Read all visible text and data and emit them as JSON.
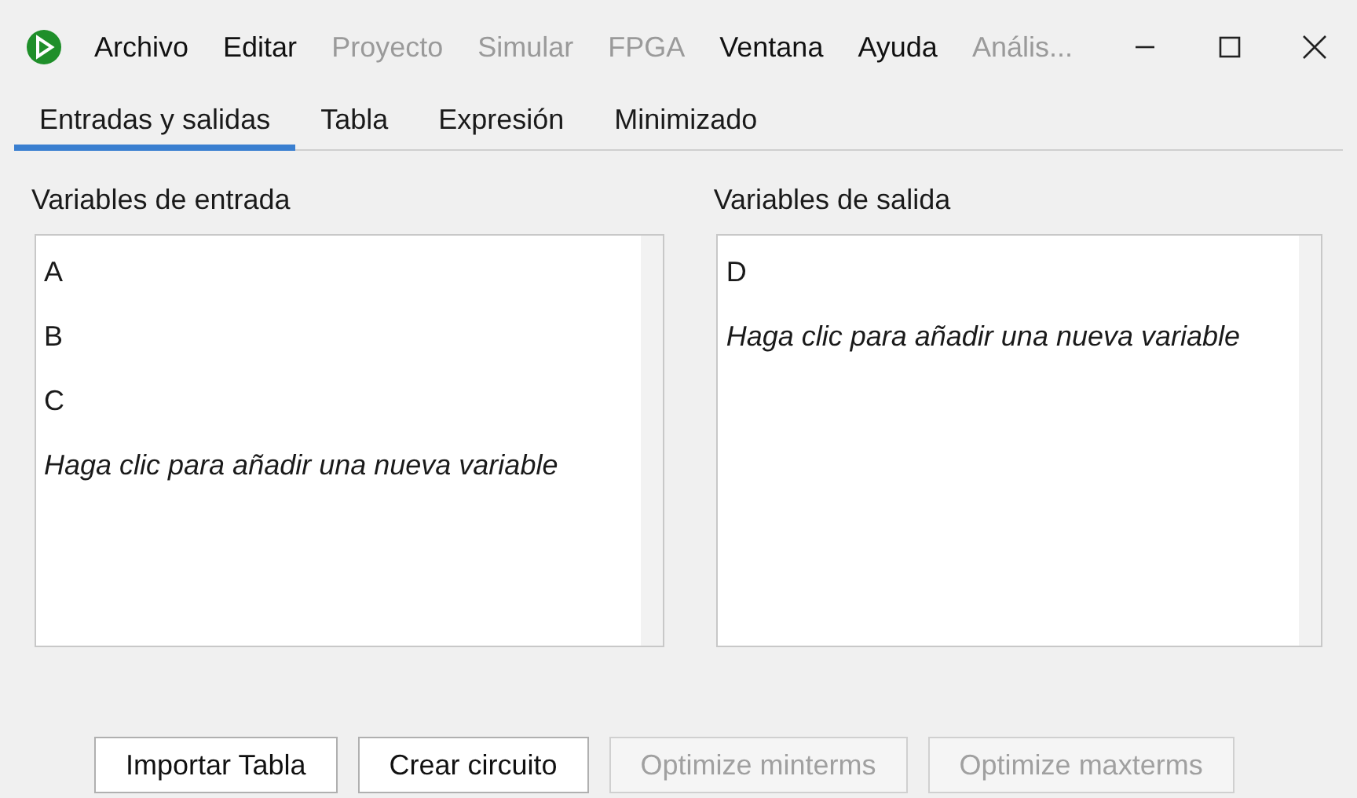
{
  "menu": [
    {
      "label": "Archivo",
      "disabled": false
    },
    {
      "label": "Editar",
      "disabled": false
    },
    {
      "label": "Proyecto",
      "disabled": true
    },
    {
      "label": "Simular",
      "disabled": true
    },
    {
      "label": "FPGA",
      "disabled": true
    },
    {
      "label": "Ventana",
      "disabled": false
    },
    {
      "label": "Ayuda",
      "disabled": false
    },
    {
      "label": "Anális...",
      "disabled": true
    }
  ],
  "tabs": [
    {
      "label": "Entradas y salidas",
      "selected": true
    },
    {
      "label": "Tabla",
      "selected": false
    },
    {
      "label": "Expresión",
      "selected": false
    },
    {
      "label": "Minimizado",
      "selected": false
    }
  ],
  "panels": [
    {
      "title": "Variables de entrada",
      "items": [
        {
          "kind": "variable",
          "text": "A"
        },
        {
          "kind": "variable",
          "text": "B"
        },
        {
          "kind": "variable",
          "text": "C"
        },
        {
          "kind": "hint",
          "text": "Haga clic para añadir una nueva variable"
        }
      ]
    },
    {
      "title": "Variables de salida",
      "items": [
        {
          "kind": "variable",
          "text": "D"
        },
        {
          "kind": "hint",
          "text": "Haga clic para añadir una nueva variable"
        }
      ]
    }
  ],
  "buttons": [
    {
      "label": "Importar Tabla",
      "disabled": false
    },
    {
      "label": "Crear circuito",
      "disabled": false
    },
    {
      "label": "Optimize minterms",
      "disabled": true
    },
    {
      "label": "Optimize maxterms",
      "disabled": true
    }
  ]
}
